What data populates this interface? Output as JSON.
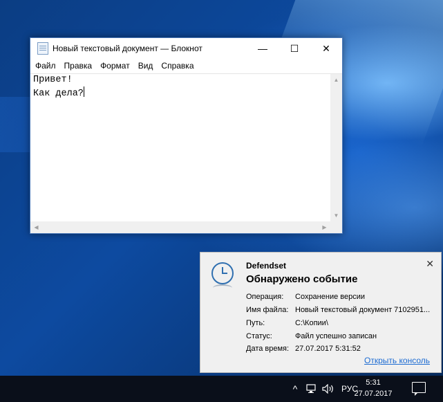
{
  "notepad": {
    "title": "Новый текстовый документ — Блокнот",
    "menu": [
      "Файл",
      "Правка",
      "Формат",
      "Вид",
      "Справка"
    ],
    "line1": "Привет!",
    "line2": "Как дела?",
    "min_glyph": "—",
    "max_glyph": "☐",
    "close_glyph": "✕"
  },
  "toast": {
    "app": "Defendset",
    "heading": "Обнаружено событие",
    "close_glyph": "✕",
    "rows": [
      {
        "key": "Операция:",
        "value": "Сохранение версии"
      },
      {
        "key": "Имя файла:",
        "value": "Новый текстовый документ 7102951..."
      },
      {
        "key": "Путь:",
        "value": "C:\\Копии\\"
      },
      {
        "key": "Статус:",
        "value": "Файл успешно записан"
      },
      {
        "key": "Дата время:",
        "value": "27.07.2017 5:31:52"
      }
    ],
    "link": "Открыть консоль"
  },
  "taskbar": {
    "chevron": "^",
    "lang": "РУС",
    "time": "5:31",
    "date": "27.07.2017"
  },
  "colors": {
    "accent": "#1c6bd2",
    "taskbar": "#0a0f1a"
  }
}
